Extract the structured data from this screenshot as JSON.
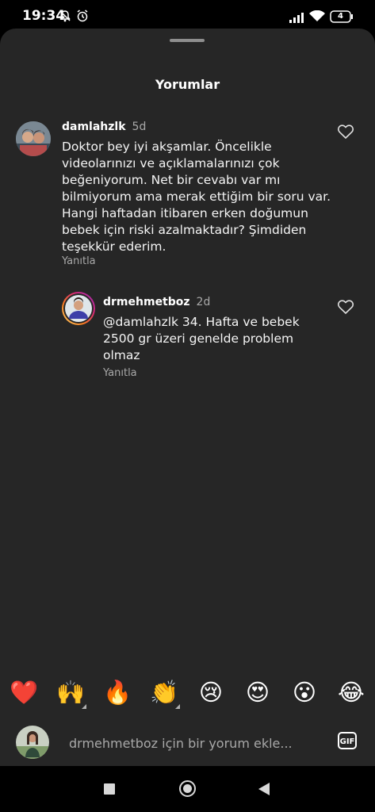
{
  "status_bar": {
    "time": "19:34",
    "battery": "4",
    "icons": [
      "notifications-off-icon",
      "alarm-icon",
      "signal-icon",
      "wifi-icon",
      "battery-icon"
    ]
  },
  "sheet": {
    "title": "Yorumlar"
  },
  "comments": [
    {
      "username": "damlahzlk",
      "time": "5d",
      "lines": [
        "Doktor bey iyi akşamlar. Öncelikle",
        "videolarınızı ve açıklamalarınızı çok",
        "beğeniyorum. Net bir cevabı var mı",
        "bilmiyorum ama merak ettiğim bir soru var.",
        "Hangi haftadan itibaren erken doğumun",
        "bebek için riski azalmaktadır? Şimdiden",
        "teşekkür ederim."
      ],
      "reply_label": "Yanıtla"
    },
    {
      "username": "drmehmetboz",
      "time": "2d",
      "lines": [
        "@damlahzlk 34. Hafta ve bebek",
        "2500 gr üzeri genelde problem",
        "olmaz"
      ],
      "reply_label": "Yanıtla"
    }
  ],
  "emoji_bar": [
    "❤️",
    "🙌",
    "🔥",
    "👏",
    "😢",
    "😍",
    "😮",
    "😂"
  ],
  "comment_input": {
    "placeholder": "drmehmetboz için bir yorum ekle...",
    "gif_label": "GIF"
  },
  "colors": {
    "sheet_bg": "#262626",
    "secondary_text": "#a8a8a8",
    "heart": "#ff3040"
  }
}
